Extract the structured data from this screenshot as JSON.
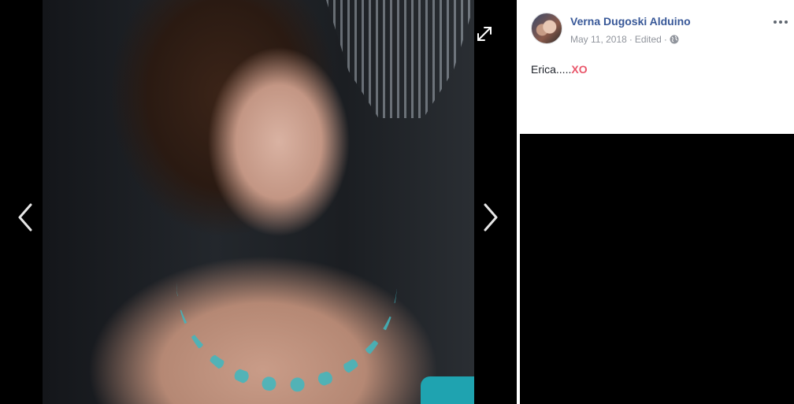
{
  "viewer": {
    "photo_alt": "photo",
    "nav_prev_icon": "chevron-left-icon",
    "nav_next_icon": "chevron-right-icon",
    "expand_icon": "fullscreen-icon"
  },
  "post": {
    "author": "Verna Dugoski Alduino",
    "date": "May 11, 2018",
    "separator": "·",
    "edited": "Edited",
    "audience_icon": "globe-icon",
    "options_icon": "more-options-icon",
    "text_prefix": "Erica.....",
    "text_emphasis": "XO"
  },
  "colors": {
    "author_link": "#385898",
    "meta_gray": "#90949c",
    "emphasis": "#e9566a",
    "panel_bg": "#ffffff",
    "viewer_bg": "#000000"
  }
}
